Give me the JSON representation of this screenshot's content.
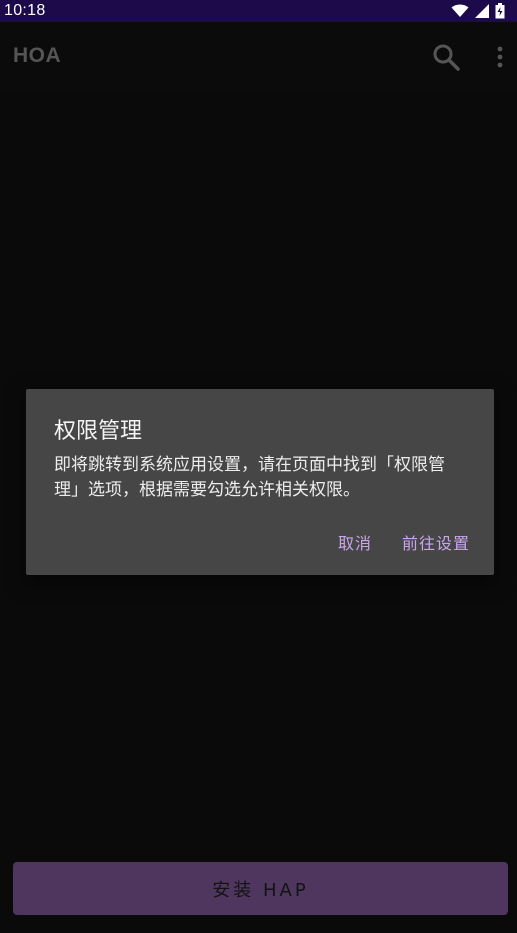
{
  "status_bar": {
    "time": "10:18",
    "icons": [
      "wifi-icon",
      "signal-icon",
      "battery-charging-icon"
    ]
  },
  "app_bar": {
    "title": "HOA",
    "actions": [
      "search-icon",
      "more-vert-icon"
    ]
  },
  "dialog": {
    "title": "权限管理",
    "message": "即将跳转到系统应用设置，请在页面中找到「权限管理」选项，根据需要勾选允许相关权限。",
    "cancel_label": "取消",
    "confirm_label": "前往设置"
  },
  "bottom": {
    "install_label": "安装 HAP"
  },
  "colors": {
    "status_bar": "#1c0a4a",
    "background": "#0b0b0b",
    "dialog": "#464646",
    "accent": "#c9a6ec",
    "install_button": "#4e365e"
  }
}
